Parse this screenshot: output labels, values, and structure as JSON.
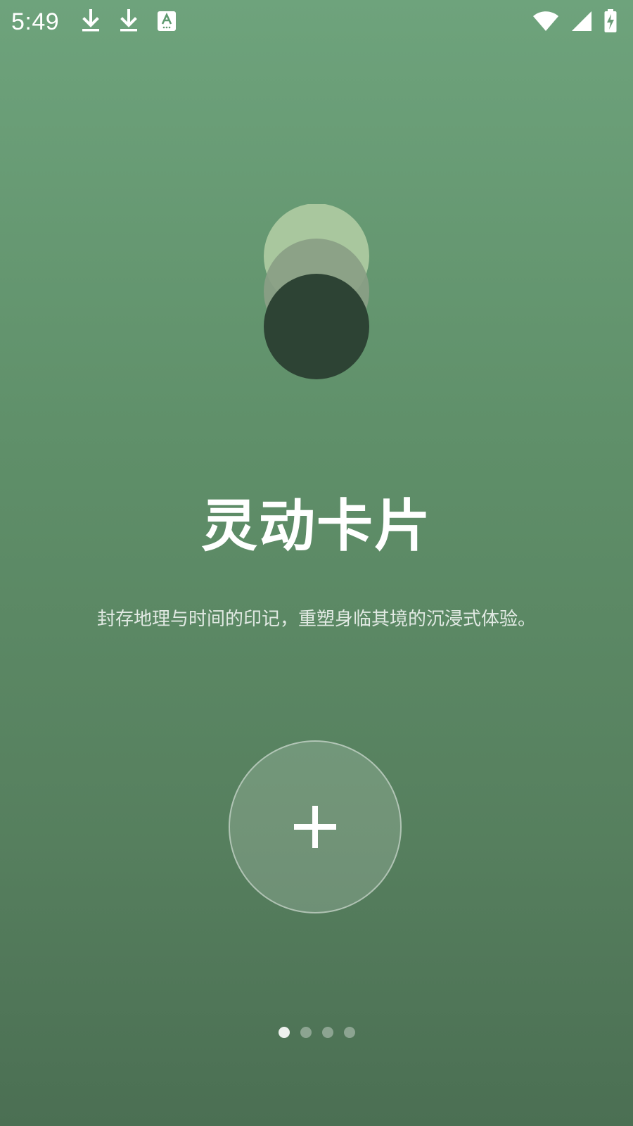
{
  "status_bar": {
    "time": "5:49",
    "icons": [
      "download-icon",
      "download-icon",
      "text-input-icon",
      "wifi-icon",
      "signal-icon",
      "battery-charging-icon"
    ]
  },
  "hero": {
    "icon": "stacked-circles-icon",
    "colors": {
      "back": "#a9c79e",
      "middle": "#8a9e86",
      "front": "#2d4334"
    }
  },
  "title": "灵动卡片",
  "subtitle": "封存地理与时间的印记，重塑身临其境的沉浸式体验。",
  "add_button": {
    "icon": "plus-icon"
  },
  "pager": {
    "count": 4,
    "active_index": 0
  },
  "colors": {
    "background_top": "#6ea37c",
    "background_bottom": "#4b6f53",
    "text": "#ffffff"
  }
}
